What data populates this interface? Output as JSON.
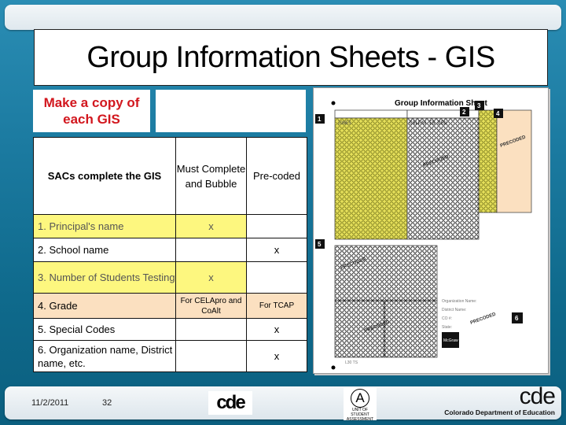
{
  "slide": {
    "title": "Group Information Sheets - GIS",
    "copy_note": "Make a copy of each GIS"
  },
  "table": {
    "header": {
      "main": "SACs complete the GIS",
      "col2": "Must Complete and Bubble",
      "col3": "Pre-coded"
    },
    "rows": [
      {
        "item": "1.  Principal's name",
        "must_complete": "x",
        "pre_coded": "",
        "highlight": "yellow"
      },
      {
        "item": "2.  School name",
        "must_complete": "",
        "pre_coded": "x",
        "highlight": "none"
      },
      {
        "item": "3.  Number of Students Testing",
        "must_complete": "x",
        "pre_coded": "",
        "highlight": "yellow"
      },
      {
        "item": "4.   Grade",
        "must_complete": "For CELApro and CoAlt",
        "pre_coded": "For TCAP",
        "highlight": "orange"
      },
      {
        "item": "5.  Special Codes",
        "must_complete": "",
        "pre_coded": "x",
        "highlight": "none"
      },
      {
        "item": "6.  Organization name, District name, etc.",
        "must_complete": "",
        "pre_coded": "x",
        "highlight": "none"
      }
    ]
  },
  "sheet_image": {
    "title": "Group Information Sheet",
    "section_numbers": [
      "1",
      "2",
      "3",
      "4",
      "5",
      "6"
    ],
    "principal_name_value": "JONES",
    "school_name_value": "COLFAX ES DEN",
    "stamp": "PRECODED",
    "labels": [
      "Organization Name:",
      "District Name:",
      "CO #:",
      "State:"
    ],
    "publisher": "McGraw Hill",
    "form_code": "L30 TS"
  },
  "footer": {
    "date": "11/2/2011",
    "page": "32",
    "logo_small": "cde",
    "usa_logo_letter": "A",
    "usa_logo_text": "UNIT OF STUDENT ASSESSMENT",
    "logo_big": "cde",
    "org_name": "Colorado Department of Education"
  },
  "colors": {
    "highlight_yellow": "#fdf77f",
    "highlight_orange": "#fbe0c0",
    "copy_note_red": "#d2171e",
    "header_navy": "#1b1f6b",
    "background_teal": "#1b7aa0"
  }
}
